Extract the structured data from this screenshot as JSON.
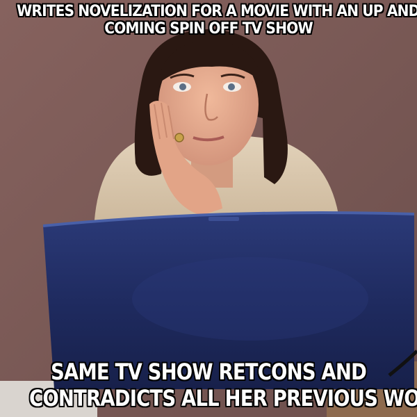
{
  "meme": {
    "top_text": [
      "WRITES NOVELIZATION FOR A MOVIE WITH AN UP AND",
      "COMING SPIN OFF TV SHOW"
    ],
    "bottom_text": [
      "SAME TV SHOW RETCONS AND",
      "CONTRADICTS ALL HER PREVIOUS WORK"
    ]
  },
  "colors": {
    "wall": "#7a5a57",
    "laptop": "#1f2a5c",
    "sweater": "#d9c7ad",
    "hair": "#2a1812",
    "skin": "#e3a98a",
    "caption_text": "#ffffff",
    "caption_outline": "#000000"
  },
  "icons": [
    "laptop-illustration",
    "woman-illustration"
  ]
}
